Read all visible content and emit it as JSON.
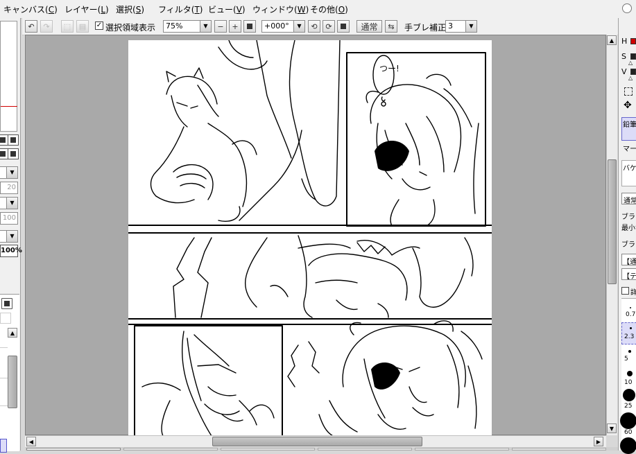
{
  "menu": [
    {
      "label": "キャンバス(",
      "key": "C",
      "tail": ")"
    },
    {
      "label": "レイヤー(",
      "key": "L",
      "tail": ")"
    },
    {
      "label": "選択(",
      "key": "S",
      "tail": ")"
    },
    {
      "label": "フィルタ(",
      "key": "T",
      "tail": ")"
    },
    {
      "label": "ビュー(",
      "key": "V",
      "tail": ")"
    },
    {
      "label": "ウィンドウ(",
      "key": "W",
      "tail": ")"
    },
    {
      "label": "その他(",
      "key": "O",
      "tail": ")"
    }
  ],
  "toolbar": {
    "show_selection_label": "選択領域表示",
    "show_selection_checked": "✓",
    "zoom_value": "75%",
    "rotation_value": "+000°",
    "blend_mode_label": "通常",
    "stabilizer_label": "手ブレ補正",
    "stabilizer_value": "3"
  },
  "left_panel": {
    "value_20": "20",
    "value_100": "100",
    "value_100pct": "100%"
  },
  "right_panel": {
    "h_label": "H",
    "s_label": "S",
    "v_label": "V",
    "tool_pencil": "鉛筆",
    "tool_marker": "マーカ",
    "tool_bucket": "バケツ",
    "blend_normal": "通常",
    "brush_label": "ブラシ",
    "min_size_label": "最小サ",
    "brush_label2": "ブラシ",
    "mode_normal": "【通",
    "mode_texture": "【テ",
    "detail_label": "詳",
    "size_07": "0.7",
    "size_23": "2.3",
    "size_5": "5",
    "size_10": "10",
    "size_25": "25",
    "size_60": "60"
  },
  "manga": {
    "speech_text": "つー!",
    "panel_note": "line-art manga page"
  },
  "colors": {
    "accent_red": "#d00000",
    "chrome": "#f0f0f0",
    "canvas_bg": "#a9a9a9"
  }
}
